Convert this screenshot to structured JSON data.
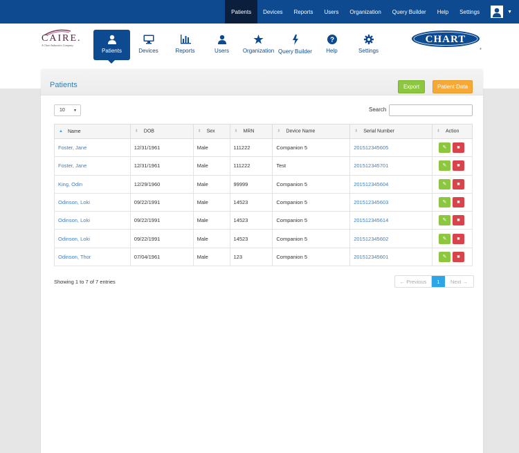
{
  "topnav": {
    "items": [
      "Patients",
      "Devices",
      "Reports",
      "Users",
      "Organization",
      "Query Builder",
      "Help",
      "Settings"
    ],
    "active": "Patients"
  },
  "logo": {
    "brand": "CAIRE.",
    "tagline": "A Chart Industries Company"
  },
  "chart_logo_text": "CHART",
  "mainnav": {
    "items": [
      {
        "label": "Patients",
        "icon": "user-icon"
      },
      {
        "label": "Devices",
        "icon": "monitor-icon"
      },
      {
        "label": "Reports",
        "icon": "bar-chart-icon"
      },
      {
        "label": "Users",
        "icon": "user-icon"
      },
      {
        "label": "Organization",
        "icon": "star-icon"
      },
      {
        "label": "Query Builder",
        "icon": "bolt-icon"
      },
      {
        "label": "Help",
        "icon": "question-icon"
      },
      {
        "label": "Settings",
        "icon": "gear-icon"
      }
    ]
  },
  "panel": {
    "title": "Patients",
    "export_label": "Export",
    "patient_data_label": "Patient Data",
    "page_length": "10",
    "search_label": "Search"
  },
  "table": {
    "headers": [
      "Name",
      "DOB",
      "Sex",
      "MRN",
      "Device Name",
      "Serial Number",
      "Action"
    ],
    "rows": [
      [
        "Foster, Jane",
        "12/31/1961",
        "Male",
        "111222",
        "Companion 5",
        "201512345605"
      ],
      [
        "Foster, Jane",
        "12/31/1961",
        "Male",
        "111222",
        "Test",
        "201512345701"
      ],
      [
        "King, Odin",
        "12/29/1960",
        "Male",
        "99999",
        "Companion 5",
        "201512345604"
      ],
      [
        "Odinson, Loki",
        "09/22/1991",
        "Male",
        "14523",
        "Companion 5",
        "201512345603"
      ],
      [
        "Odinson, Loki",
        "09/22/1991",
        "Male",
        "14523",
        "Companion 5",
        "201512345614"
      ],
      [
        "Odinson, Loki",
        "09/22/1991",
        "Male",
        "14523",
        "Companion 5",
        "201512345602"
      ],
      [
        "Odinson, Thor",
        "07/04/1961",
        "Male",
        "123",
        "Companion 5",
        "201512345601"
      ]
    ]
  },
  "footer": {
    "info": "Showing 1 to 7 of 7 entries",
    "prev": "← Previous",
    "page": "1",
    "next": "Next →"
  },
  "colors": {
    "brand_blue": "#0d4a8f",
    "export_green": "#8dc63f",
    "patient_data_orange": "#f7a937",
    "delete_red": "#d9434a",
    "link_blue": "#3b7ec2",
    "page_active": "#2fa4e7"
  }
}
